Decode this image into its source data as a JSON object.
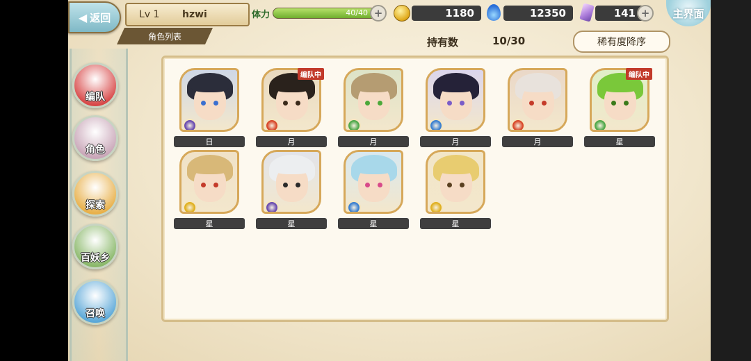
{
  "header": {
    "back_label": "返回",
    "level": "Lv 1",
    "player_name": "hzwi",
    "section_tab": "角色列表",
    "stamina_label": "体力",
    "stamina_value": "40/40",
    "stamina_fraction": 1.0,
    "gold": "1180",
    "soul": "12350",
    "crystal": "141",
    "home_label": "主界面"
  },
  "summary": {
    "held_label": "持有数",
    "held_count": "10/30",
    "sort_label": "稀有度降序"
  },
  "nav": [
    {
      "label": "编队",
      "color": "#d84848"
    },
    {
      "label": "角色",
      "color": "#c9a6b8"
    },
    {
      "label": "探索",
      "color": "#e8b04a"
    },
    {
      "label": "百妖乡",
      "color": "#8ab86a"
    },
    {
      "label": "召唤",
      "color": "#5ca8d8"
    }
  ],
  "characters": [
    {
      "tag": "日",
      "badge": "",
      "element_color": "#6a4cb0",
      "hair": "#2b2d3a",
      "bg": "#cfd8e6",
      "eye": "#3a6fd0"
    },
    {
      "tag": "月",
      "badge": "编队中",
      "element_color": "#d8482a",
      "hair": "#2a221c",
      "bg": "#e9dac0",
      "eye": "#3a2a1a"
    },
    {
      "tag": "月",
      "badge": "",
      "element_color": "#4fa84a",
      "hair": "#b59c72",
      "bg": "#dde3c8",
      "eye": "#4ca83a"
    },
    {
      "tag": "月",
      "badge": "",
      "element_color": "#3a7fd0",
      "hair": "#252238",
      "bg": "#dcd6ec",
      "eye": "#7a5cc8"
    },
    {
      "tag": "月",
      "badge": "",
      "element_color": "#d8482a",
      "hair": "#e8e2dc",
      "bg": "#ead8c8",
      "eye": "#c43a2a"
    },
    {
      "tag": "星",
      "badge": "编队中",
      "element_color": "#4fa84a",
      "hair": "#7ac83a",
      "bg": "#e0efc8",
      "eye": "#3a7a1a"
    },
    {
      "tag": "星",
      "badge": "",
      "element_color": "#e0b020",
      "hair": "#d8b878",
      "bg": "#f0e2c8",
      "eye": "#c43a2a"
    },
    {
      "tag": "星",
      "badge": "",
      "element_color": "#6a4cb0",
      "hair": "#eceef0",
      "bg": "#e2e4ea",
      "eye": "#2a2a2a"
    },
    {
      "tag": "星",
      "badge": "",
      "element_color": "#3a7fd0",
      "hair": "#a8d8ea",
      "bg": "#d8e8f0",
      "eye": "#d84a8a"
    },
    {
      "tag": "星",
      "badge": "",
      "element_color": "#e0b020",
      "hair": "#e8cc70",
      "bg": "#f2e6c8",
      "eye": "#5a4020"
    }
  ]
}
